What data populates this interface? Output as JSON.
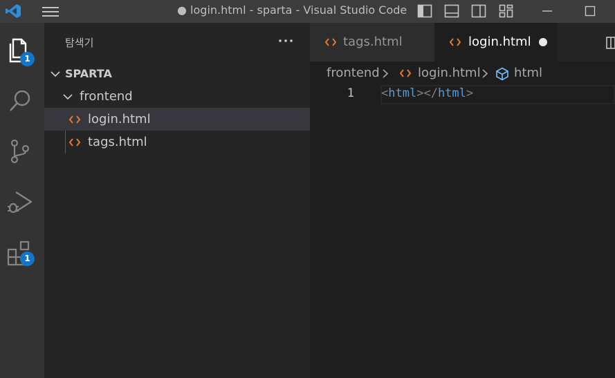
{
  "window": {
    "title": "● login.html - sparta - Visual Studio Code"
  },
  "activity_bar": {
    "items": [
      {
        "name": "explorer",
        "badge": "1"
      },
      {
        "name": "search"
      },
      {
        "name": "source-control"
      },
      {
        "name": "run-and-debug"
      },
      {
        "name": "extensions",
        "badge": "1"
      }
    ]
  },
  "sidebar": {
    "title": "탐색기",
    "root_folder": "SPARTA",
    "folder": "frontend",
    "files": [
      "login.html",
      "tags.html"
    ],
    "selected_file": "login.html"
  },
  "tabs": [
    {
      "label": "tags.html",
      "active": false,
      "dirty": false
    },
    {
      "label": "login.html",
      "active": true,
      "dirty": true
    }
  ],
  "breadcrumb": {
    "items": [
      "frontend",
      "login.html",
      "html"
    ]
  },
  "editor": {
    "line_number": "1",
    "code": {
      "open_bracket": "<",
      "tag": "html",
      "close_bracket": ">",
      "end_open": "</",
      "end_tag": "html",
      "end_close": ">"
    }
  },
  "colors": {
    "accent_badge": "#1177cc",
    "html_icon": "#e37933",
    "element_icon": "#75beff",
    "tag": "#569cd6"
  }
}
